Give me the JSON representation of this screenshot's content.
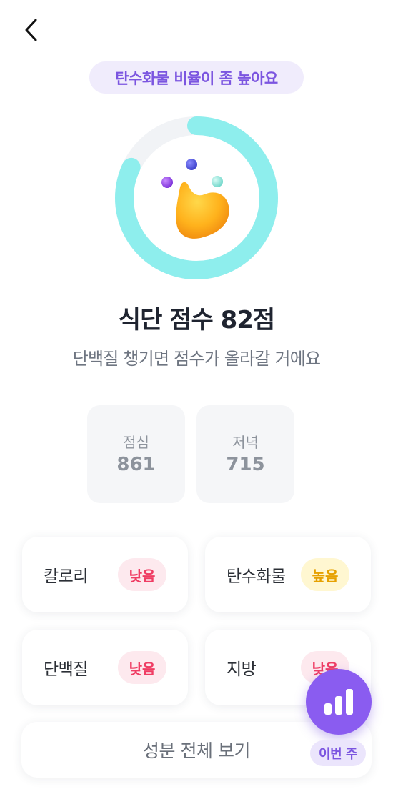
{
  "banner": {
    "text": "탄수화물 비율이 좀 높아요"
  },
  "score": {
    "title": "식단 점수 82점",
    "subtitle": "단백질 챙기면 점수가 올라갈 거에요",
    "value": 82,
    "max": 100
  },
  "meals": [
    {
      "name": "점심",
      "value": "861"
    },
    {
      "name": "저녁",
      "value": "715"
    }
  ],
  "nutrients": [
    {
      "label": "칼로리",
      "status": "낮음",
      "level": "low"
    },
    {
      "label": "탄수화물",
      "status": "높음",
      "level": "high"
    },
    {
      "label": "단백질",
      "status": "낮음",
      "level": "low"
    },
    {
      "label": "지방",
      "status": "낮음",
      "level": "low"
    }
  ],
  "view_all": {
    "label": "성분 전체 보기"
  },
  "fab": {
    "label": "이번 주",
    "icon": "bar-chart-icon"
  },
  "icons": {
    "back": "chevron-left-icon",
    "mascot": "mascot-illustration"
  },
  "colors": {
    "ring_progress": "#8eeeed",
    "ring_track": "#f1f3f6",
    "accent": "#8a5cf0",
    "low": "#ef3d64",
    "high": "#e6a100"
  }
}
